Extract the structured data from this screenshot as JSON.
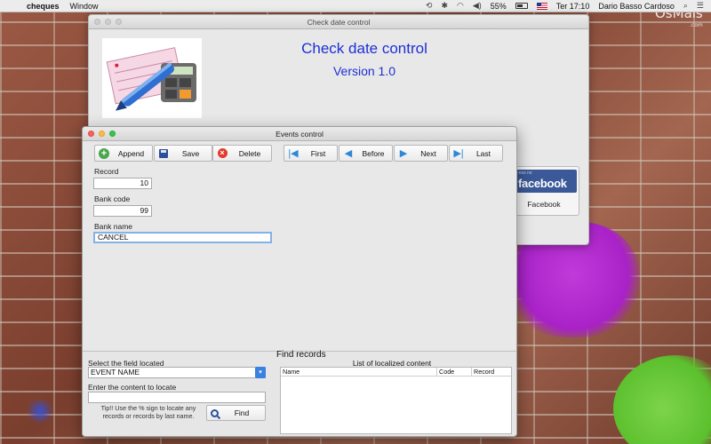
{
  "menubar": {
    "app_name": "cheques",
    "menus": [
      "Window"
    ],
    "battery": "55%",
    "clock": "Ter 17:10",
    "user": "Dario Basso Cardoso"
  },
  "brand": {
    "name": "OsMais",
    "suffix": ".com"
  },
  "back_window": {
    "title": "Check date control",
    "heading": "Check date control",
    "version": "Version 1.0",
    "facebook": {
      "small_text": "-nos no",
      "logo_text": "facebook",
      "label": "Facebook"
    }
  },
  "front_window": {
    "title": "Events control",
    "toolbar": {
      "append": "Append",
      "save": "Save",
      "delete": "Delete",
      "first": "First",
      "before": "Before",
      "next": "Next",
      "last": "Last"
    },
    "form": {
      "record_label": "Record",
      "record_value": "10",
      "bank_code_label": "Bank code",
      "bank_code_value": "99",
      "bank_name_label": "Bank name",
      "bank_name_value": "CANCEL"
    },
    "search": {
      "select_label": "Select the field located",
      "select_value": "EVENT NAME",
      "content_label": "Enter the content to locate",
      "content_value": "",
      "tip": "Tip!! Use the % sign to locate any records or records by last name.",
      "find_button": "Find"
    },
    "results": {
      "title": "Find records",
      "list_title": "List of localized content",
      "columns": [
        "Name",
        "Code",
        "Record"
      ]
    }
  },
  "colors": {
    "accent_blue": "#1d2fd6",
    "facebook_blue": "#3b5998",
    "select_blue": "#3b82e0"
  }
}
